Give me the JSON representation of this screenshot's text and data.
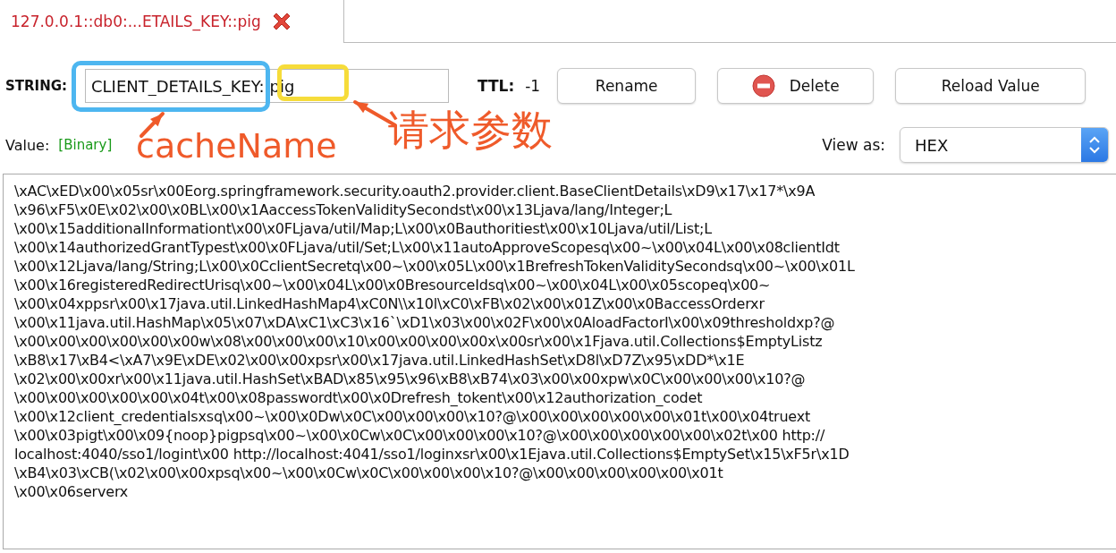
{
  "tab": {
    "title": "127.0.0.1::db0:...ETAILS_KEY::pig",
    "selected": true
  },
  "key": {
    "type_label": "STRING:",
    "name": "CLIENT_DETAILS_KEY::pig",
    "ttl_label": "TTL:",
    "ttl": "-1"
  },
  "buttons": [
    {
      "label": "Rename",
      "kind": "plain"
    },
    {
      "label": "Delete",
      "kind": "delete"
    },
    {
      "label": "Reload Value",
      "kind": "plain"
    }
  ],
  "value": {
    "label": "Value:",
    "format": "[Binary]",
    "view_label": "View as:",
    "view": "HEX"
  },
  "lines": [
    "\\xAC\\xED\\x00\\x05sr\\x00Eorg.springframework.security.oauth2.provider.client.BaseClientDetails\\xD9\\x17\\x17*\\x9A",
    "\\x96\\xF5\\x0E\\x02\\x00\\x0BL\\x00\\x1AaccessTokenValiditySecondst\\x00\\x13Ljava/lang/Integer;L",
    "\\x00\\x15additionalInformationt\\x00\\x0FLjava/util/Map;L\\x00\\x0Bauthoritiest\\x00\\x10Ljava/util/List;L",
    "\\x00\\x14authorizedGrantTypest\\x00\\x0FLjava/util/Set;L\\x00\\x11autoApproveScopesq\\x00~\\x00\\x04L\\x00\\x08clientIdt",
    "\\x00\\x12Ljava/lang/String;L\\x00\\x0CclientSecretq\\x00~\\x00\\x05L\\x00\\x1BrefreshTokenValiditySecondsq\\x00~\\x00\\x01L",
    "\\x00\\x16registeredRedirectUrisq\\x00~\\x00\\x04L\\x00\\x0BresourceIdsq\\x00~\\x00\\x04L\\x00\\x05scopeq\\x00~",
    "\\x00\\x04xppsr\\x00\\x17java.util.LinkedHashMap4\\xC0N\\\\x10l\\xC0\\xFB\\x02\\x00\\x01Z\\x00\\x0BaccessOrderxr",
    "\\x00\\x11java.util.HashMap\\x05\\x07\\xDA\\xC1\\xC3\\x16`\\xD1\\x03\\x00\\x02F\\x00\\x0AloadFactorI\\x00\\x09thresholdxp?@",
    "\\x00\\x00\\x00\\x00\\x00\\x00w\\x08\\x00\\x00\\x00\\x10\\x00\\x00\\x00\\x00x\\x00sr\\x00\\x1Fjava.util.Collections$EmptyListz",
    "\\xB8\\x17\\xB4<\\xA7\\x9E\\xDE\\x02\\x00\\x00xpsr\\x00\\x17java.util.LinkedHashSet\\xD8l\\xD7Z\\x95\\xDD*\\x1E",
    "\\x02\\x00\\x00xr\\x00\\x11java.util.HashSet\\xBAD\\x85\\x95\\x96\\xB8\\xB74\\x03\\x00\\x00xpw\\x0C\\x00\\x00\\x00\\x10?@",
    "\\x00\\x00\\x00\\x00\\x00\\x04t\\x00\\x08passwordt\\x00\\x0Drefresh_tokent\\x00\\x12authorization_codet",
    "\\x00\\x12client_credentialsxsq\\x00~\\x00\\x0Dw\\x0C\\x00\\x00\\x00\\x10?@\\x00\\x00\\x00\\x00\\x00\\x01t\\x00\\x04truext",
    "\\x00\\x03pigt\\x00\\x09{noop}pigpsq\\x00~\\x00\\x0Cw\\x0C\\x00\\x00\\x00\\x10?@\\x00\\x00\\x00\\x00\\x00\\x02t\\x00 http://",
    "localhost:4040/sso1/logint\\x00 http://localhost:4041/sso1/loginxsr\\x00\\x1Ejava.util.Collections$EmptySet\\x15\\xF5r\\x1D",
    "\\xB4\\x03\\xCB(\\x02\\x00\\x00xpsq\\x00~\\x00\\x0Cw\\x0C\\x00\\x00\\x00\\x10?@\\x00\\x00\\x00\\x00\\x00\\x01t",
    "\\x00\\x06serverx"
  ],
  "annotations": [
    {
      "kind": "box",
      "color": "#4db6f0"
    },
    {
      "kind": "box",
      "color": "#f6dc3a"
    },
    {
      "kind": "arrow",
      "color": "#ef5a2a"
    },
    {
      "kind": "arrow",
      "color": "#ef5a2a"
    },
    {
      "kind": "label",
      "text": "cacheName",
      "color": "#ef5a2a"
    },
    {
      "kind": "label",
      "text": "请求参数",
      "color": "#ef5a2a"
    }
  ]
}
